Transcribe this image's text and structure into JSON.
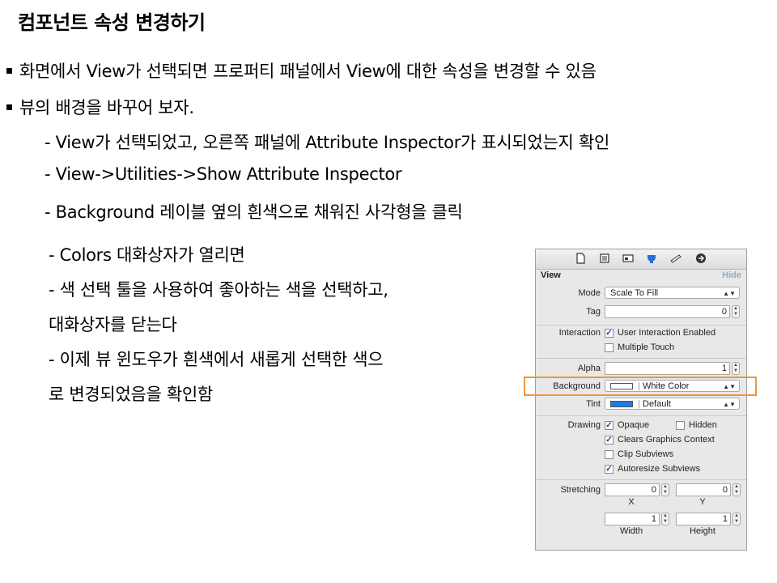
{
  "title": "컴포넌트 속성 변경하기",
  "bullets": [
    "화면에서 View가 선택되면 프로퍼티 패널에서 View에 대한 속성을 변경할 수 있음",
    "뷰의 배경을 바꾸어 보자."
  ],
  "steps": [
    "- View가 선택되었고, 오른쪽 패널에 Attribute Inspector가 표시되었는지 확인",
    "- View->Utilities->Show Attribute Inspector",
    "- Background 레이블 옆의 흰색으로 채워진 사각형을 클릭"
  ],
  "left_steps": [
    "- Colors 대화상자가 열리면",
    "- 색 선택 툴을 사용하여 좋아하는 색을 선택하고,",
    "대화상자를 닫는다",
    "- 이제 뷰 윈도우가 흰색에서 새롭게 선택한 색으",
    "로 변경되었음을 확인함"
  ],
  "inspector": {
    "section": "View",
    "hide": "Hide",
    "mode_label": "Mode",
    "mode_value": "Scale To Fill",
    "tag_label": "Tag",
    "tag_value": "0",
    "interaction_label": "Interaction",
    "user_interaction": "User Interaction Enabled",
    "multiple_touch": "Multiple Touch",
    "alpha_label": "Alpha",
    "alpha_value": "1",
    "background_label": "Background",
    "background_value": "White Color",
    "tint_label": "Tint",
    "tint_value": "Default",
    "drawing_label": "Drawing",
    "opaque": "Opaque",
    "hidden": "Hidden",
    "clears_graphics": "Clears Graphics Context",
    "clip_subviews": "Clip Subviews",
    "autoresize": "Autoresize Subviews",
    "stretching_label": "Stretching",
    "stretch_x": "0",
    "stretch_y": "0",
    "stretch_w": "1",
    "stretch_h": "1",
    "x_label": "X",
    "y_label": "Y",
    "width_label": "Width",
    "height_label": "Height",
    "tint_color": "#1e7be0",
    "highlight_color": "#f0953a"
  }
}
